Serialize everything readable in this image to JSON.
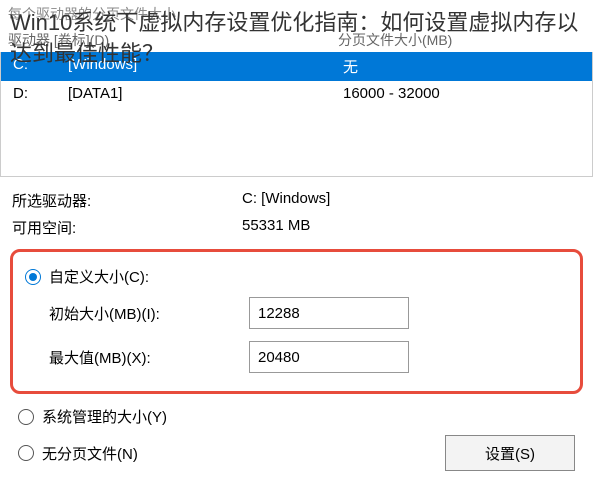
{
  "faded_header": "每个驱动器的分页文件大小",
  "overlay_title": "Win10系统下虚拟内存设置优化指南：如何设置虚拟内存以达到最佳性能？",
  "columns": {
    "drive": "驱动器 [卷标](D)",
    "pagefile": "分页文件大小(MB)"
  },
  "drives": [
    {
      "letter": "C:",
      "label": "[Windows]",
      "size": "无",
      "selected": true
    },
    {
      "letter": "D:",
      "label": "[DATA1]",
      "size": "16000 - 32000",
      "selected": false
    }
  ],
  "info": {
    "selected_drive_label": "所选驱动器:",
    "selected_drive_value": "C:  [Windows]",
    "free_space_label": "可用空间:",
    "free_space_value": "55331 MB"
  },
  "custom": {
    "radio_label": "自定义大小(C):",
    "initial_label": "初始大小(MB)(I):",
    "initial_value": "12288",
    "max_label": "最大值(MB)(X):",
    "max_value": "20480"
  },
  "options": {
    "system_managed": "系统管理的大小(Y)",
    "no_pagefile": "无分页文件(N)"
  },
  "buttons": {
    "set": "设置(S)"
  }
}
